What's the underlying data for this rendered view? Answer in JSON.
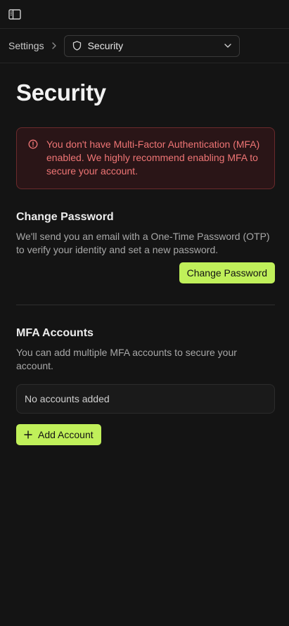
{
  "topbar": {
    "toggle_icon": "sidebar-toggle-icon"
  },
  "breadcrumb": {
    "parent": "Settings",
    "separator_icon": "chevron-right-icon",
    "current": "Security",
    "current_icon": "shield-icon",
    "dropdown_icon": "chevron-down-icon"
  },
  "page": {
    "title": "Security"
  },
  "alert": {
    "icon": "info-circle-icon",
    "text": "You don't have Multi-Factor Authentication (MFA) enabled. We highly recommend enabling MFA to secure your account.",
    "color": "#ef7575"
  },
  "change_password": {
    "title": "Change Password",
    "description": "We'll send you an email with a One-Time Password (OTP) to verify your identity and set a new password.",
    "button_label": "Change Password"
  },
  "mfa": {
    "title": "MFA Accounts",
    "description": "You can add multiple MFA accounts to secure your account.",
    "empty_text": "No accounts added",
    "add_button_label": "Add Account",
    "add_icon": "plus-icon"
  },
  "colors": {
    "accent": "#c0f05a",
    "background": "#141414",
    "danger": "#ef7575"
  }
}
